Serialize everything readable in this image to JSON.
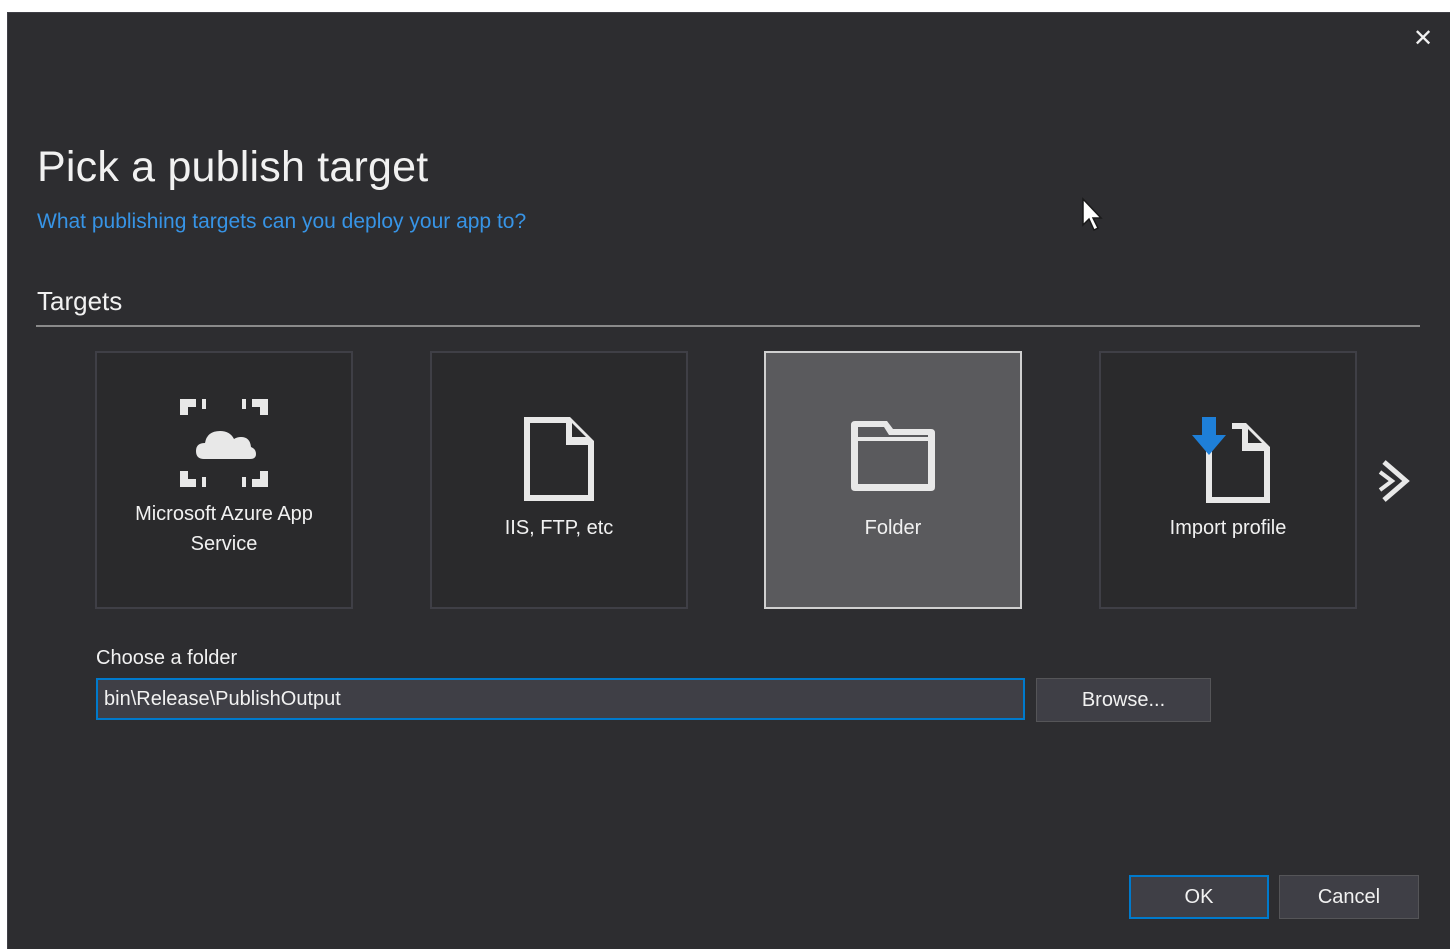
{
  "dialog": {
    "close_icon": "close-icon",
    "title": "Pick a publish target",
    "help_link": "What publishing targets can you deploy your app to?",
    "section_title": "Targets"
  },
  "targets": [
    {
      "label": "Microsoft Azure App Service",
      "icon": "azure-app-service-icon",
      "selected": false
    },
    {
      "label": "IIS, FTP, etc",
      "icon": "document-icon",
      "selected": false
    },
    {
      "label": "Folder",
      "icon": "folder-icon",
      "selected": true
    },
    {
      "label": "Import profile",
      "icon": "import-profile-icon",
      "selected": false
    }
  ],
  "folder": {
    "label": "Choose a folder",
    "value": "bin\\Release\\PublishOutput",
    "browse_label": "Browse..."
  },
  "actions": {
    "ok_label": "OK",
    "cancel_label": "Cancel"
  },
  "colors": {
    "background": "#2d2d30",
    "accent": "#007acc",
    "link": "#3794e6",
    "selected_tile": "#5a5a5d"
  }
}
